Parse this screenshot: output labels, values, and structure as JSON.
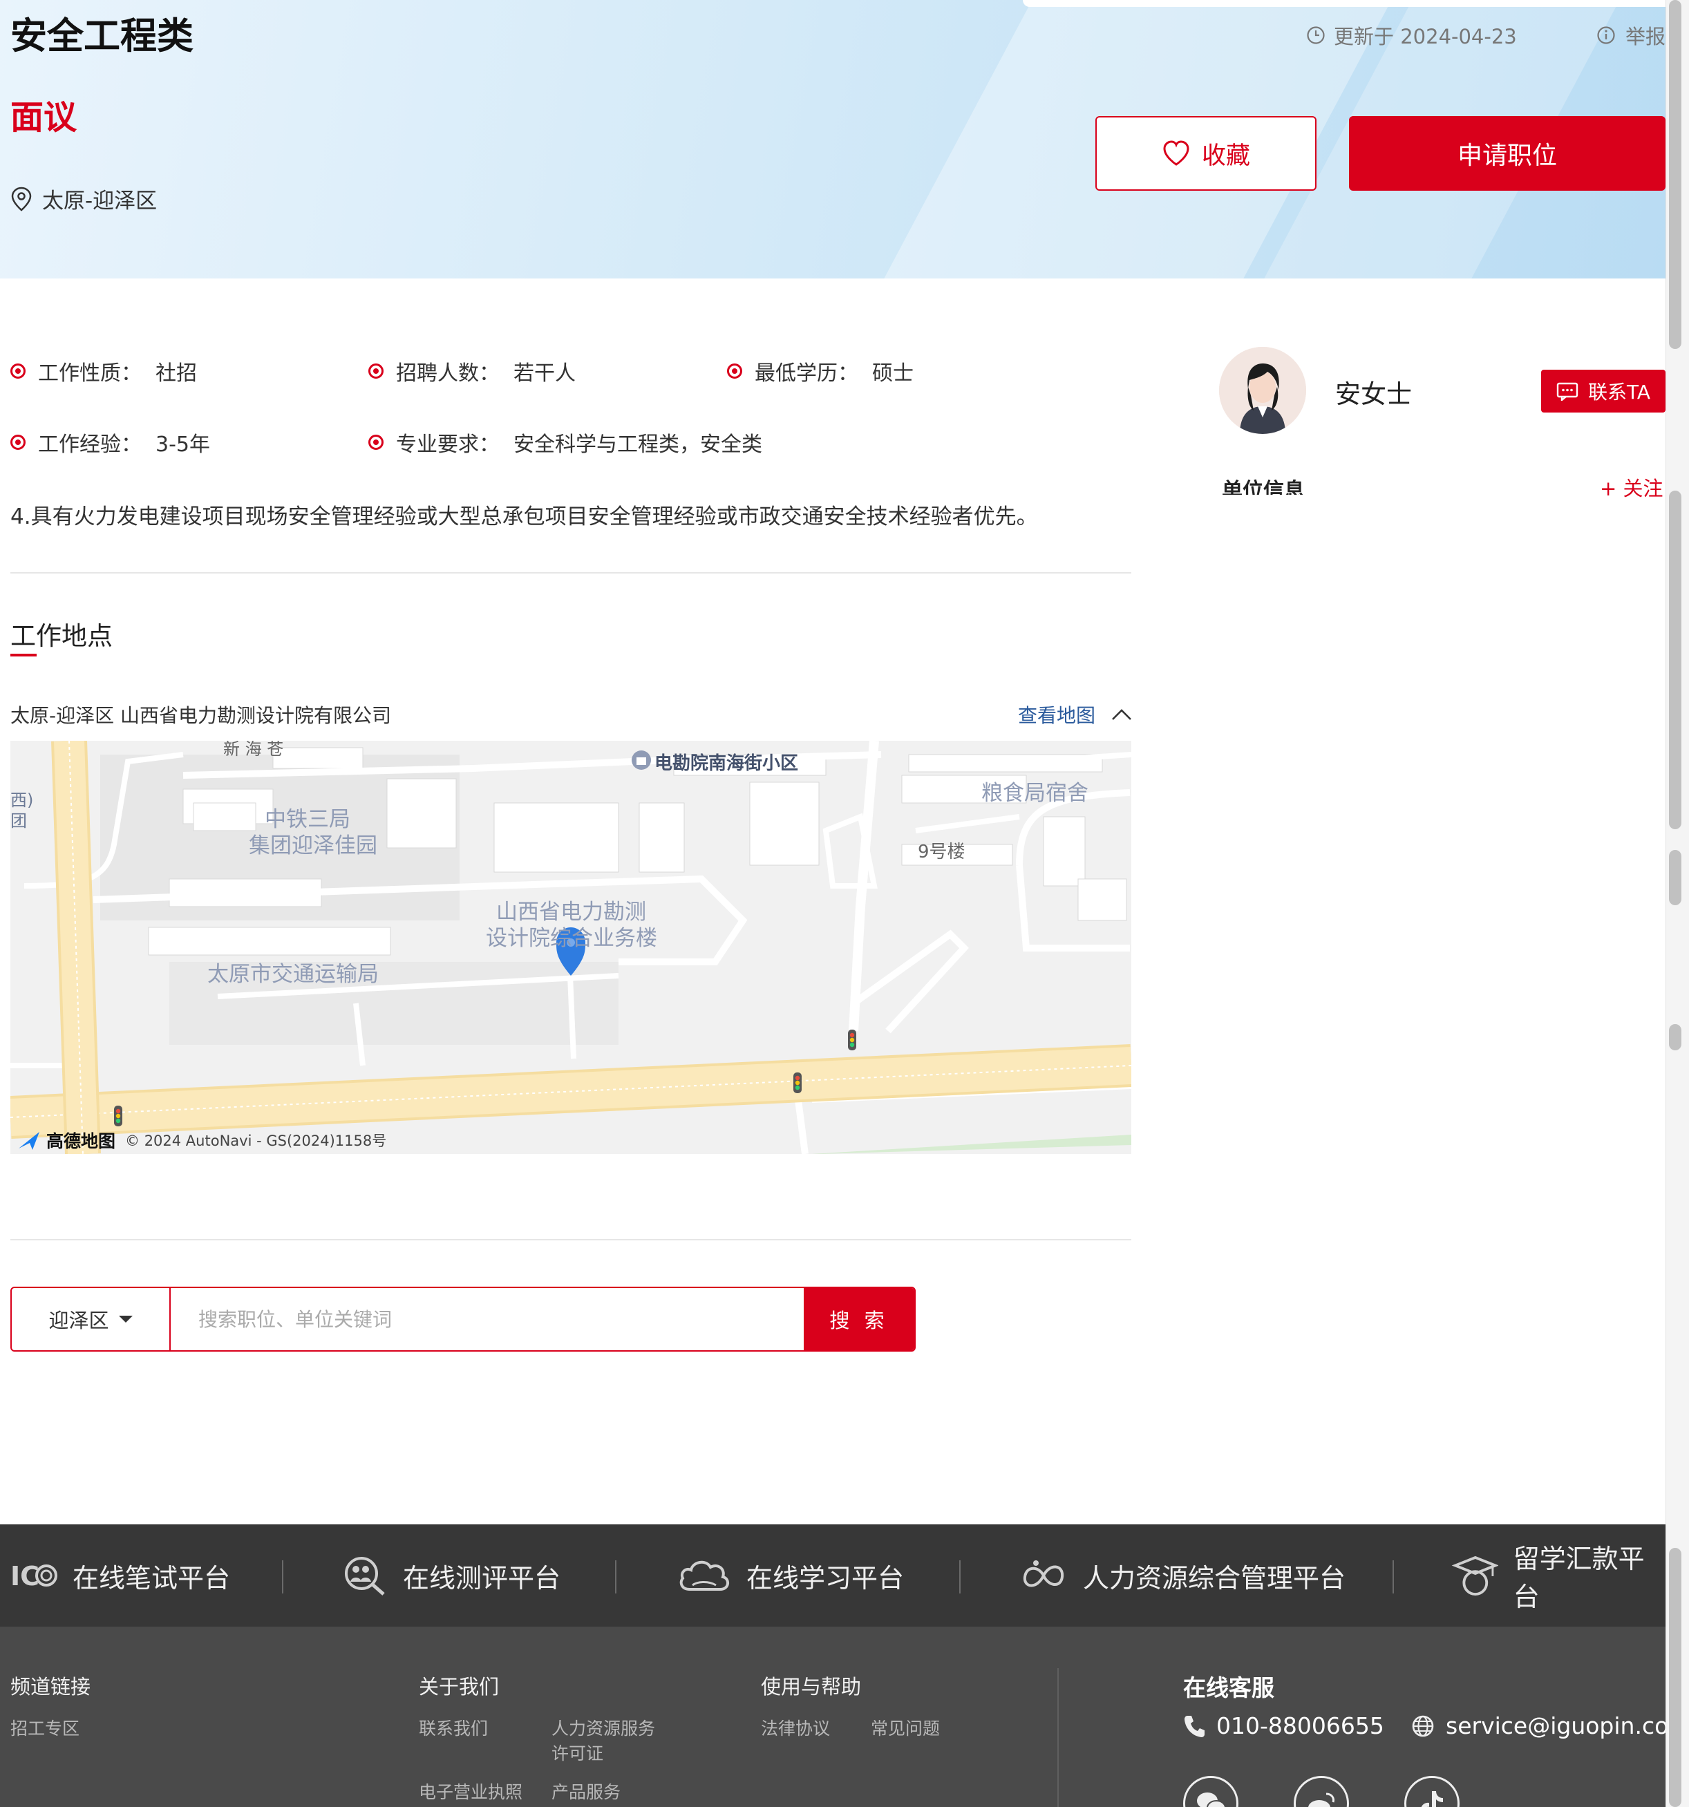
{
  "job": {
    "title": "安全工程类",
    "salary": "面议",
    "location": "太原-迎泽区",
    "updated": "更新于 2024-04-23",
    "report": "举报",
    "favorite_label": "收藏",
    "apply_label": "申请职位"
  },
  "attributes": [
    {
      "label": "工作性质：",
      "value": "社招"
    },
    {
      "label": "招聘人数：",
      "value": "若干人"
    },
    {
      "label": "最低学历：",
      "value": "硕士"
    },
    {
      "label": "工作经验：",
      "value": "3-5年"
    },
    {
      "label": "专业要求：",
      "value": "安全科学与工程类，安全类"
    }
  ],
  "description_line": "4.具有火力发电建设项目现场安全管理经验或大型总承包项目安全管理经验或市政交通安全技术经验者优先。",
  "contact": {
    "name": "安女士",
    "contact_label": "联系TA",
    "unit_info_title": "单位信息",
    "follow_label": "+ 关注"
  },
  "work_location": {
    "title": "工作地点",
    "address": "太原-迎泽区 山西省电力勘测设计院有限公司",
    "view_map_label": "查看地图"
  },
  "map": {
    "labels": {
      "top_poi": "电勘院南海街小区",
      "grain": "粮食局宿舍",
      "building9": "9号楼",
      "crcc_1": "中铁三局",
      "crcc_2": "集团迎泽佳园",
      "target_1": "山西省电力勘测",
      "target_2": "设计院综合业务楼",
      "transport": "太原市交通运输局",
      "edge_1": "西)",
      "edge_2": "团",
      "top_cut": "新 海 苍"
    },
    "logo": "高德地图",
    "copyright": "© 2024 AutoNavi - GS(2024)1158号",
    "marker_color": "#2f7ce0"
  },
  "search": {
    "district": "迎泽区",
    "placeholder": "搜索职位、单位关键词",
    "button_label": "搜 索"
  },
  "platforms": [
    {
      "label": "在线笔试平台",
      "icon": "ice-logo-icon"
    },
    {
      "label": "在线测评平台",
      "icon": "assessment-icon"
    },
    {
      "label": "在线学习平台",
      "icon": "cloud-icon"
    },
    {
      "label": "人力资源综合管理平台",
      "icon": "hr-loop-icon"
    },
    {
      "label": "留学汇款平台",
      "icon": "graduation-cap-icon"
    }
  ],
  "footer": {
    "channel_title": "频道链接",
    "channel_links": [
      "招工专区"
    ],
    "about_title": "关于我们",
    "about_links": [
      "联系我们",
      "人力资源服务许可证",
      "电子营业执照",
      "产品服务"
    ],
    "help_title": "使用与帮助",
    "help_links": [
      "法律协议",
      "常见问题"
    ],
    "service_title": "在线客服",
    "phone": "010-88006655",
    "email": "service@iguopin.com",
    "social_icons": [
      "wechat-icon",
      "weibo-icon",
      "douyin-icon"
    ]
  },
  "colors": {
    "brand_red": "#d9001b",
    "link_blue": "#2a5a9c",
    "footer_dark": "#373737",
    "footer_gray": "#4a4a4a"
  }
}
